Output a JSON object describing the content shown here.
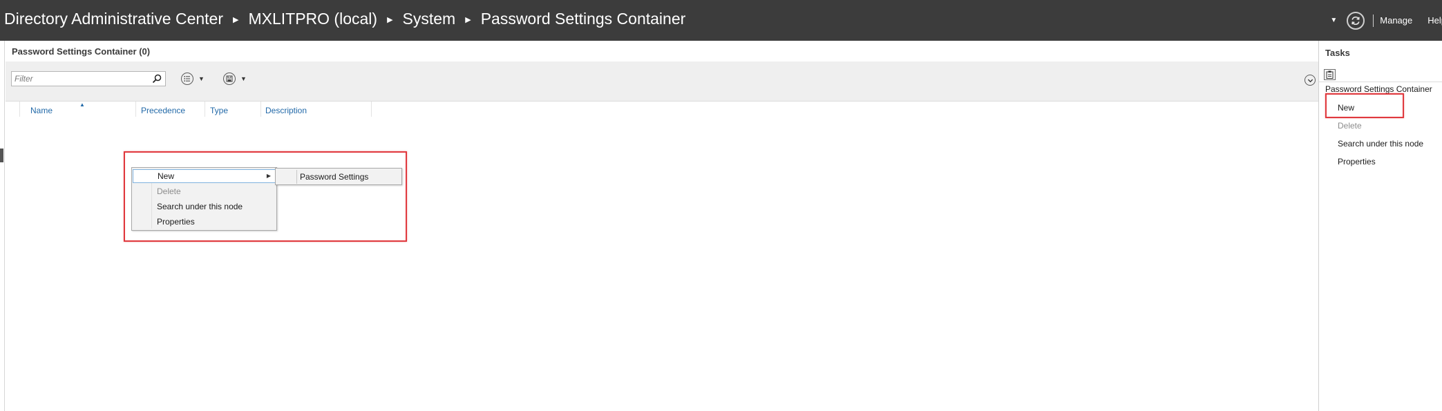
{
  "titlebar": {
    "breadcrumb": [
      "Directory Administrative Center",
      "MXLITPRO (local)",
      "System",
      "Password Settings Container"
    ],
    "manage_label": "Manage",
    "help_label": "Help",
    "refresh_icon": "refresh-icon"
  },
  "main": {
    "title": "Password Settings Container  (0)",
    "filter_placeholder": "Filter",
    "columns": [
      "Name",
      "Precedence",
      "Type",
      "Description"
    ]
  },
  "context_menu": {
    "items": [
      {
        "label": "New",
        "state": "active",
        "has_submenu": true
      },
      {
        "label": "Delete",
        "state": "disabled"
      },
      {
        "label": "Search under this node",
        "state": "normal"
      },
      {
        "label": "Properties",
        "state": "normal"
      }
    ],
    "submenu": [
      "Password Settings"
    ]
  },
  "tasks": {
    "title": "Tasks",
    "section": "Password Settings Container",
    "items": [
      {
        "label": "New",
        "state": "normal"
      },
      {
        "label": "Delete",
        "state": "disabled"
      },
      {
        "label": "Search under this node",
        "state": "normal"
      },
      {
        "label": "Properties",
        "state": "normal"
      }
    ]
  },
  "colors": {
    "titlebar_bg": "#3c3c3c",
    "column_header": "#2269a8",
    "highlight_box": "#e0393e"
  }
}
